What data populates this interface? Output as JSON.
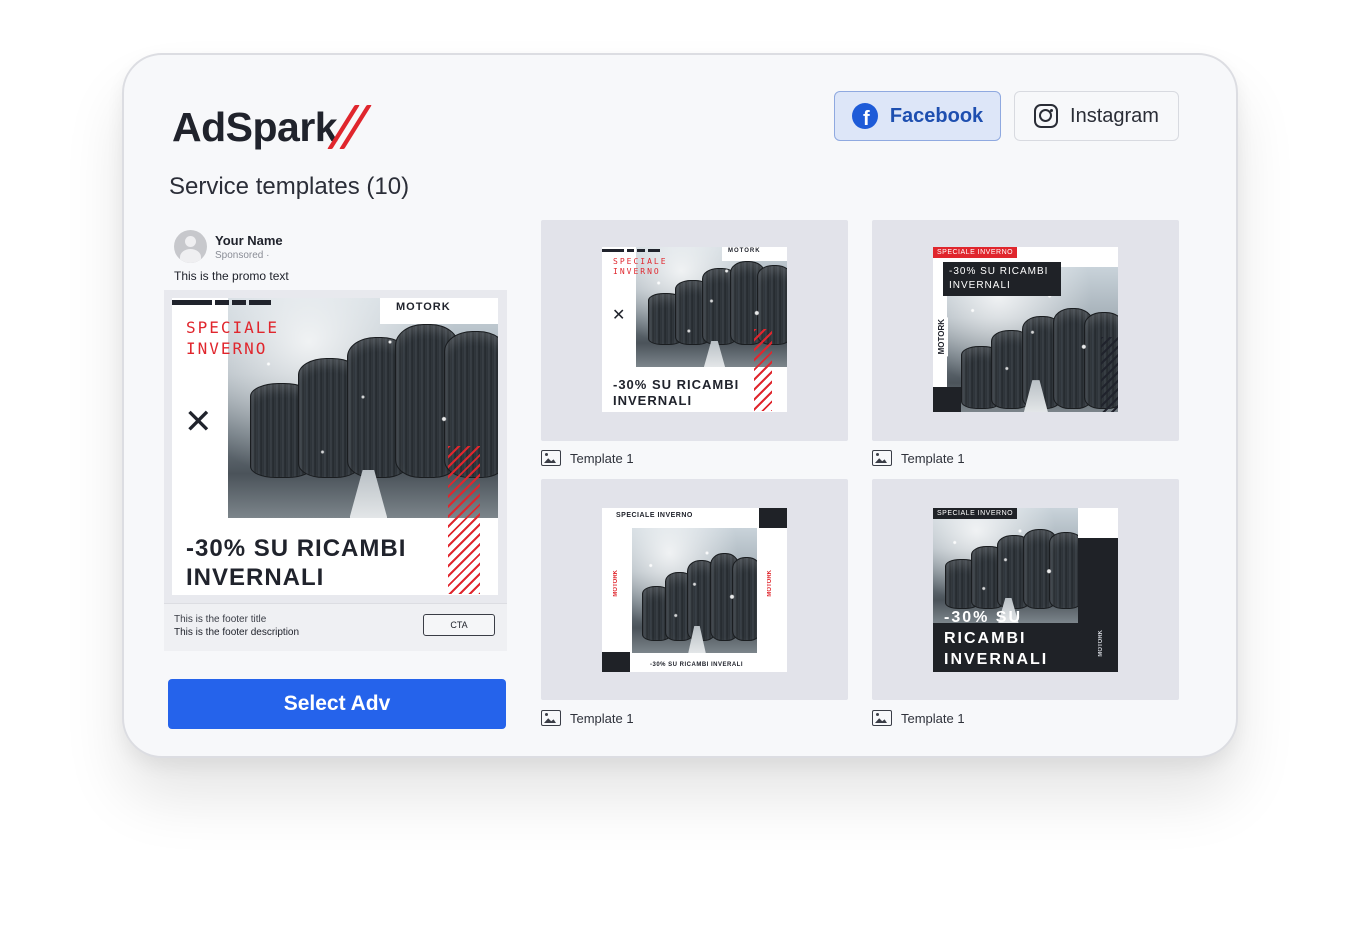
{
  "app": {
    "logo_text": "AdSpark"
  },
  "tabs": [
    {
      "label": "Facebook",
      "active": true
    },
    {
      "label": "Instagram",
      "active": false
    }
  ],
  "section": {
    "title": "Service templates (10)"
  },
  "preview": {
    "user_name": "Your Name",
    "sponsored": "Sponsored ·",
    "promo_text": "This is the promo text",
    "footer_title": "This is the footer title",
    "footer_description": "This is the footer description",
    "cta": "CTA"
  },
  "ad": {
    "brand": "MOTORK",
    "red_line1": "SPECIALE",
    "red_line2": "INVERNO",
    "headline_line1": "-30% SU RICAMBI",
    "headline_line2": "INVERNALI",
    "speciale_inverno": "SPECIALE INVERNO",
    "inline_headline": "-30% SU RICAMBI INVERALI",
    "stack_line1": "-30% SU",
    "stack_line2": "RICAMBI",
    "stack_line3": "INVERNALI"
  },
  "select_button": "Select Adv",
  "templates": [
    {
      "label": "Template 1"
    },
    {
      "label": "Template 1"
    },
    {
      "label": "Template 1"
    },
    {
      "label": "Template 1"
    }
  ],
  "colors": {
    "accent": "#2563eb",
    "brand_red": "#e0262d",
    "facebook": "#1e5bd8"
  }
}
